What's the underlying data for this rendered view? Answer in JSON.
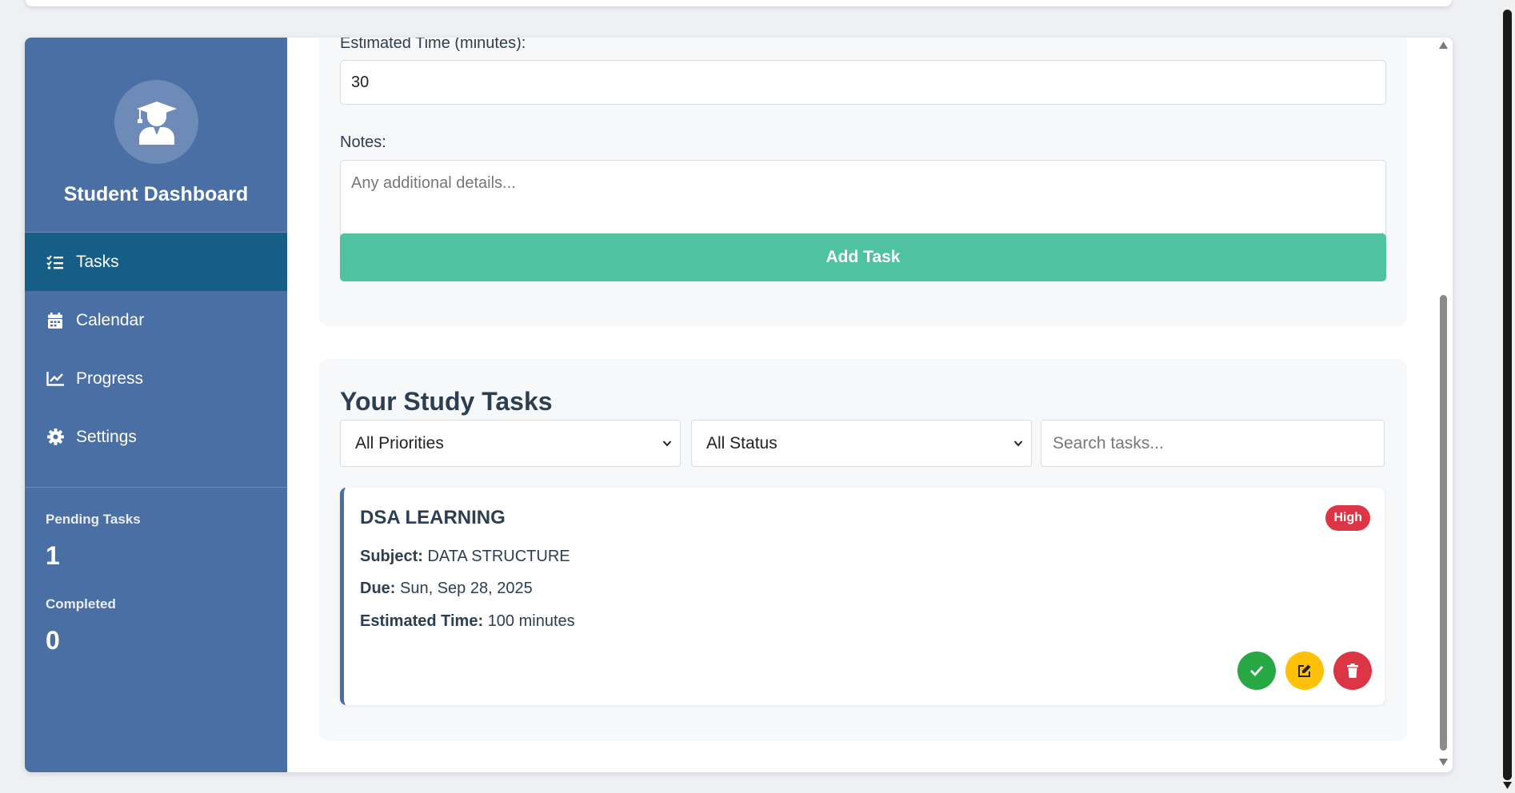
{
  "sidebar": {
    "brand": "Student Dashboard",
    "avatar_icon": "user-graduate-icon",
    "nav": [
      {
        "label": "Tasks",
        "icon": "tasks-list-icon",
        "active": true
      },
      {
        "label": "Calendar",
        "icon": "calendar-icon",
        "active": false
      },
      {
        "label": "Progress",
        "icon": "chart-line-icon",
        "active": false
      },
      {
        "label": "Settings",
        "icon": "gear-icon",
        "active": false
      }
    ],
    "stats": {
      "pending_label": "Pending Tasks",
      "pending_value": "1",
      "completed_label": "Completed",
      "completed_value": "0"
    }
  },
  "form": {
    "estimated_time_label": "Estimated Time (minutes):",
    "estimated_time_value": "30",
    "notes_label": "Notes:",
    "notes_placeholder": "Any additional details...",
    "add_button": "Add Task",
    "add_button_color": "#4fc3a1"
  },
  "tasks": {
    "title": "Your Study Tasks",
    "priority_filter": "All Priorities",
    "status_filter": "All Status",
    "search_placeholder": "Search tasks...",
    "items": [
      {
        "name": "DSA LEARNING",
        "priority": "High",
        "subject_label": "Subject:",
        "subject": "DATA STRUCTURE",
        "due_label": "Due:",
        "due": "Sun, Sep 28, 2025",
        "time_label": "Estimated Time:",
        "time": "100 minutes"
      }
    ]
  },
  "colors": {
    "sidebar": "#4a6fa5",
    "active_nav": "#175e87",
    "complete": "#28a745",
    "edit": "#ffc107",
    "delete": "#dc3545",
    "high_badge": "#dc3545"
  }
}
